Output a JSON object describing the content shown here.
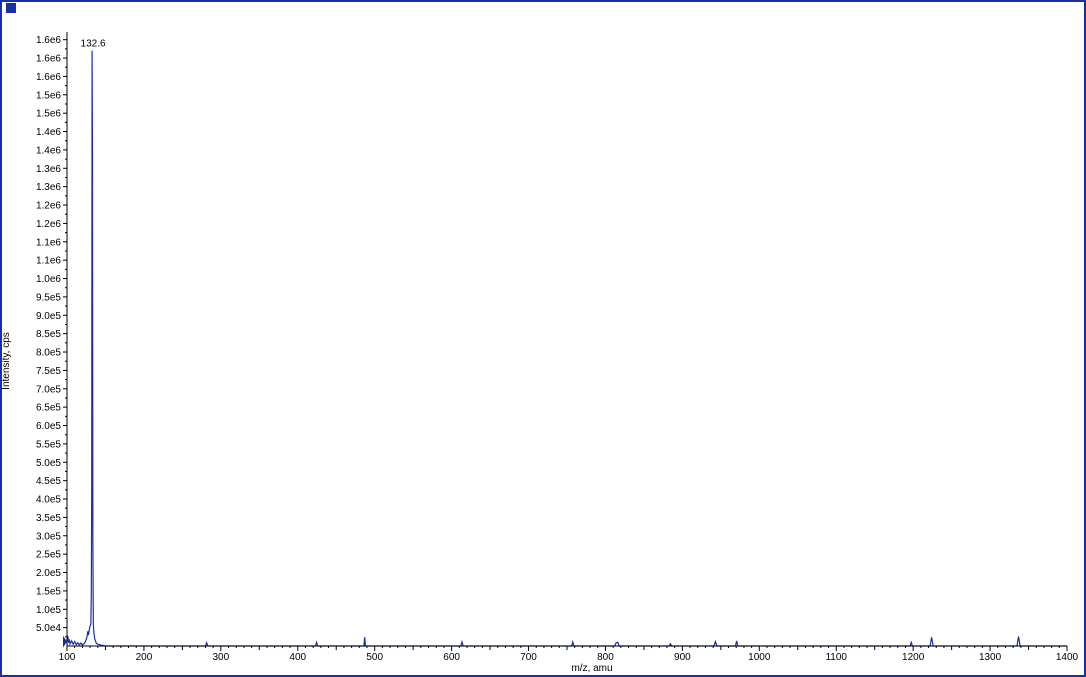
{
  "chart_data": {
    "type": "line",
    "title": "",
    "xlabel": "m/z, amu",
    "ylabel": "Intensity, cps",
    "xlim": [
      100,
      1400
    ],
    "ylim": [
      0,
      1660000
    ],
    "x_ticks": [
      "100",
      "200",
      "300",
      "400",
      "500",
      "600",
      "700",
      "800",
      "900",
      "1000",
      "1100",
      "1200",
      "1300",
      "1400"
    ],
    "y_ticks": [
      {
        "value": 50000,
        "label": "5.0e4"
      },
      {
        "value": 100000,
        "label": "1.0e5"
      },
      {
        "value": 150000,
        "label": "1.5e5"
      },
      {
        "value": 200000,
        "label": "2.0e5"
      },
      {
        "value": 250000,
        "label": "2.5e5"
      },
      {
        "value": 300000,
        "label": "3.0e5"
      },
      {
        "value": 350000,
        "label": "3.5e5"
      },
      {
        "value": 400000,
        "label": "4.0e5"
      },
      {
        "value": 450000,
        "label": "4.5e5"
      },
      {
        "value": 500000,
        "label": "5.0e5"
      },
      {
        "value": 550000,
        "label": "5.5e5"
      },
      {
        "value": 600000,
        "label": "6.0e5"
      },
      {
        "value": 650000,
        "label": "6.5e5"
      },
      {
        "value": 700000,
        "label": "7.0e5"
      },
      {
        "value": 750000,
        "label": "7.5e5"
      },
      {
        "value": 800000,
        "label": "8.0e5"
      },
      {
        "value": 850000,
        "label": "8.5e5"
      },
      {
        "value": 900000,
        "label": "9.0e5"
      },
      {
        "value": 950000,
        "label": "9.5e5"
      },
      {
        "value": 1000000,
        "label": "1.0e6"
      },
      {
        "value": 1050000,
        "label": "1.1e6"
      },
      {
        "value": 1100000,
        "label": "1.1e6"
      },
      {
        "value": 1150000,
        "label": "1.2e6"
      },
      {
        "value": 1200000,
        "label": "1.2e6"
      },
      {
        "value": 1250000,
        "label": "1.3e6"
      },
      {
        "value": 1300000,
        "label": "1.3e6"
      },
      {
        "value": 1350000,
        "label": "1.4e6"
      },
      {
        "value": 1400000,
        "label": "1.4e6"
      },
      {
        "value": 1450000,
        "label": "1.5e6"
      },
      {
        "value": 1500000,
        "label": "1.5e6"
      },
      {
        "value": 1550000,
        "label": "1.6e6"
      },
      {
        "value": 1600000,
        "label": "1.6e6"
      },
      {
        "value": 1650000,
        "label": "1.6e6"
      }
    ],
    "peak_label": {
      "text": "132.6",
      "x": 132.6,
      "y": 1620000
    },
    "series": [
      {
        "color": "#1a2ea8",
        "points": [
          [
            100,
            12000
          ],
          [
            101,
            28000
          ],
          [
            102,
            9000
          ],
          [
            103,
            18000
          ],
          [
            104,
            6000
          ],
          [
            106,
            14000
          ],
          [
            108,
            5000
          ],
          [
            110,
            12000
          ],
          [
            112,
            4000
          ],
          [
            114,
            9000
          ],
          [
            116,
            3000
          ],
          [
            118,
            8000
          ],
          [
            120,
            3000
          ],
          [
            122,
            6000
          ],
          [
            124,
            12000
          ],
          [
            126,
            25000
          ],
          [
            127,
            40000
          ],
          [
            128,
            30000
          ],
          [
            129,
            45000
          ],
          [
            130,
            55000
          ],
          [
            131,
            60000
          ],
          [
            131.6,
            140000
          ],
          [
            132.1,
            400000
          ],
          [
            132.6,
            1620000
          ],
          [
            133.1,
            1350000
          ],
          [
            133.6,
            300000
          ],
          [
            134.2,
            60000
          ],
          [
            135,
            35000
          ],
          [
            136,
            20000
          ],
          [
            138,
            8000
          ],
          [
            140,
            5000
          ],
          [
            145,
            2000
          ],
          [
            150,
            0
          ],
          [
            280,
            0
          ],
          [
            281.5,
            9000
          ],
          [
            283,
            0
          ],
          [
            423,
            0
          ],
          [
            424.5,
            10000
          ],
          [
            426,
            0
          ],
          [
            486,
            0
          ],
          [
            487,
            24000
          ],
          [
            488,
            0
          ],
          [
            612,
            0
          ],
          [
            613.5,
            11000
          ],
          [
            615,
            0
          ],
          [
            756,
            0
          ],
          [
            757.5,
            11000
          ],
          [
            759,
            0
          ],
          [
            812,
            0
          ],
          [
            814,
            9000
          ],
          [
            816,
            10000
          ],
          [
            818,
            0
          ],
          [
            883,
            0
          ],
          [
            884.5,
            6000
          ],
          [
            886,
            0
          ],
          [
            941,
            0
          ],
          [
            943,
            12000
          ],
          [
            945,
            0
          ],
          [
            969,
            0
          ],
          [
            970.5,
            14000
          ],
          [
            972,
            0
          ],
          [
            1196,
            0
          ],
          [
            1197.5,
            10000
          ],
          [
            1199,
            0
          ],
          [
            1222,
            0
          ],
          [
            1224,
            24000
          ],
          [
            1226,
            0
          ],
          [
            1335,
            0
          ],
          [
            1337,
            26000
          ],
          [
            1339,
            0
          ],
          [
            1400,
            0
          ]
        ]
      }
    ]
  }
}
